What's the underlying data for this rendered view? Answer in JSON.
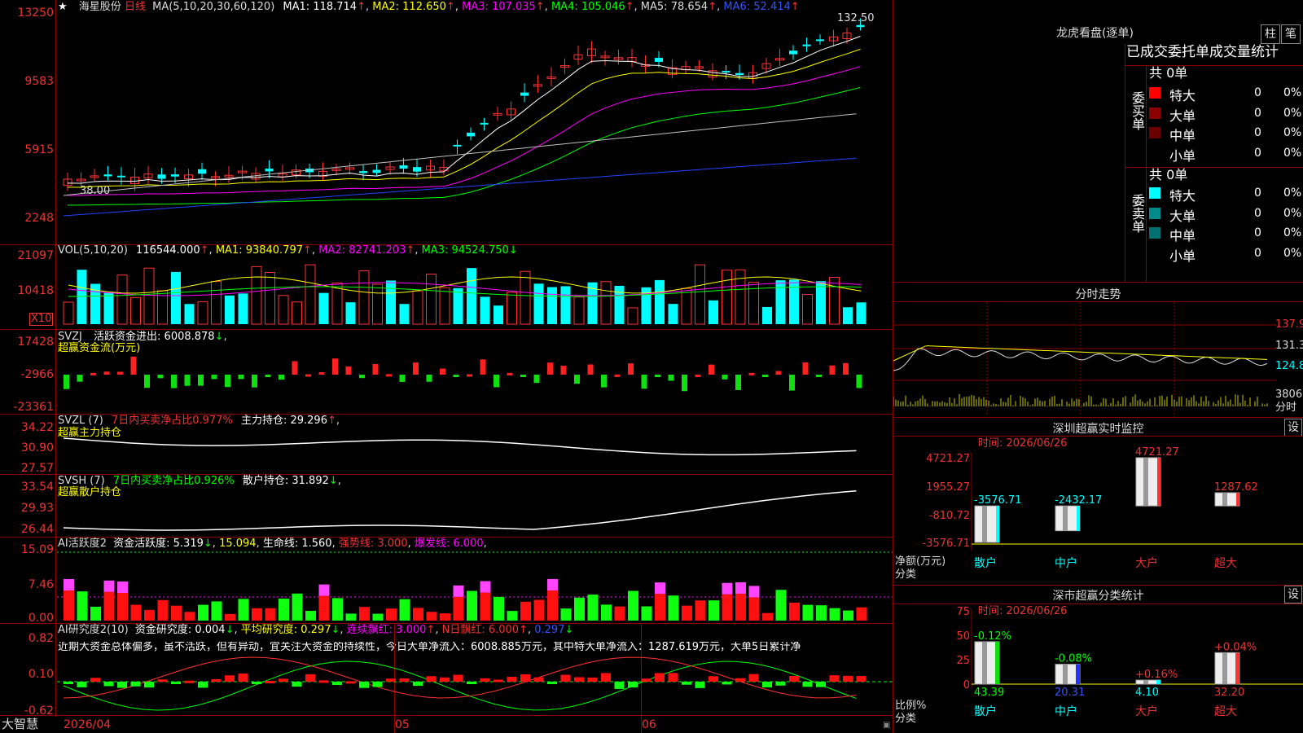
{
  "header": {
    "star_icon": "★",
    "stock_name": "海星股份",
    "period": "日线",
    "ma_label": "MA(5,10,20,30,60,120)",
    "ma1": "MA1: 118.714",
    "ma2": "MA2: 112.650",
    "ma3": "MA3: 107.035",
    "ma4": "MA4: 105.046",
    "ma5": "MA5: 78.654",
    "ma6": "MA6: 52.414",
    "last_price": "132.50",
    "low_label": "38.00",
    "colors": {
      "ma1": "#ffffff",
      "ma2": "#ffff00",
      "ma3": "#ff00ff",
      "ma4": "#00ff00",
      "ma5": "#c0c0c0",
      "ma6": "#2244ff",
      "up": "#ff3333",
      "down": "#00ffff"
    }
  },
  "price_axis": [
    "13250",
    "9583",
    "5915",
    "2248"
  ],
  "volume": {
    "label": "VOL(5,10,20)",
    "value": "116544.000",
    "ma1": "MA1: 93840.797",
    "ma2": "MA2: 82741.203",
    "ma3": "MA3: 94524.750",
    "axis": [
      "21097",
      "10418"
    ],
    "unit": "X10"
  },
  "svzj": {
    "label": "SVZJ",
    "title": "活跃资金进出: 6008.878",
    "subtitle": "超赢资金流(万元)",
    "axis": [
      "17428",
      "-2966",
      "-23361"
    ]
  },
  "svzl": {
    "label": "SVZL (7)",
    "ratio": "7日内买卖净占比0.977%",
    "hold": "主力持仓: 29.296",
    "subtitle": "超赢主力持仓",
    "axis": [
      "34.22",
      "30.90",
      "27.57"
    ]
  },
  "svsh": {
    "label": "SVSH (7)",
    "ratio": "7日内买卖净占比0.926%",
    "hold": "散户持仓: 31.892",
    "subtitle": "超赢散户持仓",
    "axis": [
      "33.54",
      "29.93",
      "26.44"
    ]
  },
  "ai_active": {
    "label": "AI活跃度2",
    "activity": "资金活跃度: 5.319",
    "v2": "15.094",
    "life": "生命线: 1.560",
    "strong": "强势线: 3.000",
    "burst": "爆发线: 6.000",
    "axis": [
      "15.09",
      "7.46",
      "0.00"
    ]
  },
  "ai_research": {
    "label": "AI研究度2(10)",
    "research": "资金研究度: 0.004",
    "avg": "平均研究度: 0.297",
    "red_days": "连续飘红: 3.000",
    "n_red": "N日飘红: 6.000",
    "v5": "0.297",
    "axis": [
      "0.82",
      "0.10",
      "-0.62"
    ],
    "comment": "近期大资金总体偏多，虽不活跃，但有异动，宜关注大资金的持续性，今日大单净流入：6008.885万元，其中特大单净流入：1287.619万元，大单5日累计净"
  },
  "date_axis": {
    "d1": "2026/04",
    "d2": "05",
    "d3": "06"
  },
  "brand": "大智慧",
  "right": {
    "dragon_title": "龙虎看盘(逐单)",
    "btn_bar": "柱",
    "btn_pen": "笔",
    "section_title": "已成交委托单成交量统计",
    "buy": {
      "side": "委买单",
      "total": "共 0单",
      "rows": [
        {
          "name": "特大",
          "v": "0",
          "p": "0%",
          "color": "#ff0000"
        },
        {
          "name": "大单",
          "v": "0",
          "p": "0%",
          "color": "#8b0000"
        },
        {
          "name": "中单",
          "v": "0",
          "p": "0%",
          "color": "#6b0000"
        },
        {
          "name": "小单",
          "v": "0",
          "p": "0%",
          "color": ""
        }
      ]
    },
    "sell": {
      "side": "委卖单",
      "total": "共 0单",
      "rows": [
        {
          "name": "特大",
          "v": "0",
          "p": "0%",
          "color": "#00ffff"
        },
        {
          "name": "大单",
          "v": "0",
          "p": "0%",
          "color": "#008b8b"
        },
        {
          "name": "中单",
          "v": "0",
          "p": "0%",
          "color": "#007070"
        },
        {
          "name": "小单",
          "v": "0",
          "p": "0%",
          "color": ""
        }
      ]
    },
    "intraday": {
      "title": "分时走势",
      "axis": [
        "137.9",
        "131.3",
        "124.8",
        "3806",
        "分时"
      ]
    },
    "sz_monitor": {
      "title": "深圳超赢实时监控",
      "setting": "设",
      "time": "时间: 2026/06/26",
      "axis": [
        "4721.27",
        "1955.27",
        "-810.72",
        "-3576.71"
      ],
      "ylabel1": "净额(万元)",
      "ylabel2": "分类",
      "categories": [
        "散户",
        "中户",
        "大户",
        "超大"
      ],
      "values": [
        -3576.71,
        -2432.17,
        4721.27,
        1287.62
      ],
      "value_labels": [
        "-3576.71",
        "-2432.17",
        "4721.27",
        "1287.62"
      ]
    },
    "sz_class": {
      "title": "深市超赢分类统计",
      "setting": "设",
      "time": "时间: 2026/06/26",
      "axis": [
        "75",
        "50",
        "25",
        "0"
      ],
      "ylabel1": "比例%",
      "ylabel2": "分类",
      "categories": [
        "散户",
        "中户",
        "大户",
        "超大"
      ],
      "values": [
        43.39,
        20.31,
        4.1,
        32.2
      ],
      "value_labels": [
        "43.39",
        "20.31",
        "4.10",
        "32.20"
      ],
      "change_labels": [
        "-0.12%",
        "-0.08%",
        "+0.16%",
        "+0.04%"
      ]
    }
  }
}
